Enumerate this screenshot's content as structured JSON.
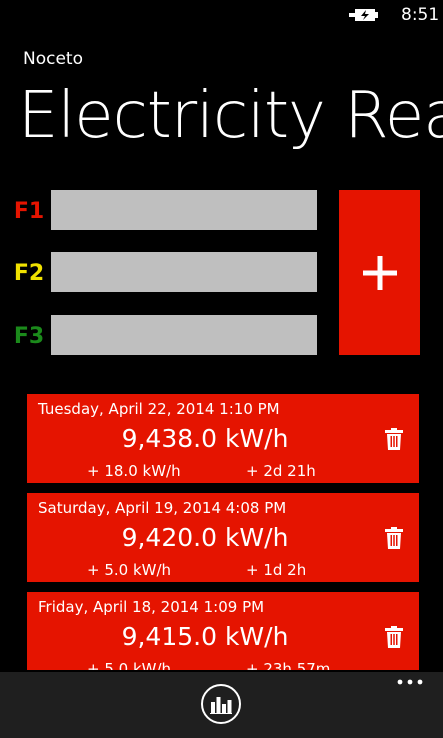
{
  "status": {
    "time": "8:51",
    "battery_icon": "battery-charging-icon"
  },
  "app": {
    "name": "Noceto",
    "title": "Electricity Reading"
  },
  "form": {
    "fields": [
      {
        "label": "F1",
        "color": "#e51400",
        "value": ""
      },
      {
        "label": "F2",
        "color": "#f0e100",
        "value": ""
      },
      {
        "label": "F3",
        "color": "#1b8a1b",
        "value": ""
      }
    ],
    "add_icon": "plus-icon"
  },
  "readings": [
    {
      "date": "Tuesday, April 22, 2014 1:10 PM",
      "reading": "9,438.0 kW/h",
      "delta": "+ 18.0 kW/h",
      "elapsed": "+ 2d 21h"
    },
    {
      "date": "Saturday, April 19, 2014 4:08 PM",
      "reading": "9,420.0 kW/h",
      "delta": "+ 5.0 kW/h",
      "elapsed": "+ 1d 2h"
    },
    {
      "date": "Friday, April 18, 2014 1:09 PM",
      "reading": "9,415.0 kW/h",
      "delta": "+ 5.0 kW/h",
      "elapsed": "+ 23h 57m"
    }
  ],
  "appbar": {
    "chart_icon": "bar-chart-icon",
    "more_icon": "more-dots-icon"
  },
  "colors": {
    "accent": "#e51400",
    "field_bg": "#bfbfbf",
    "appbar_bg": "#1f1f1f"
  }
}
